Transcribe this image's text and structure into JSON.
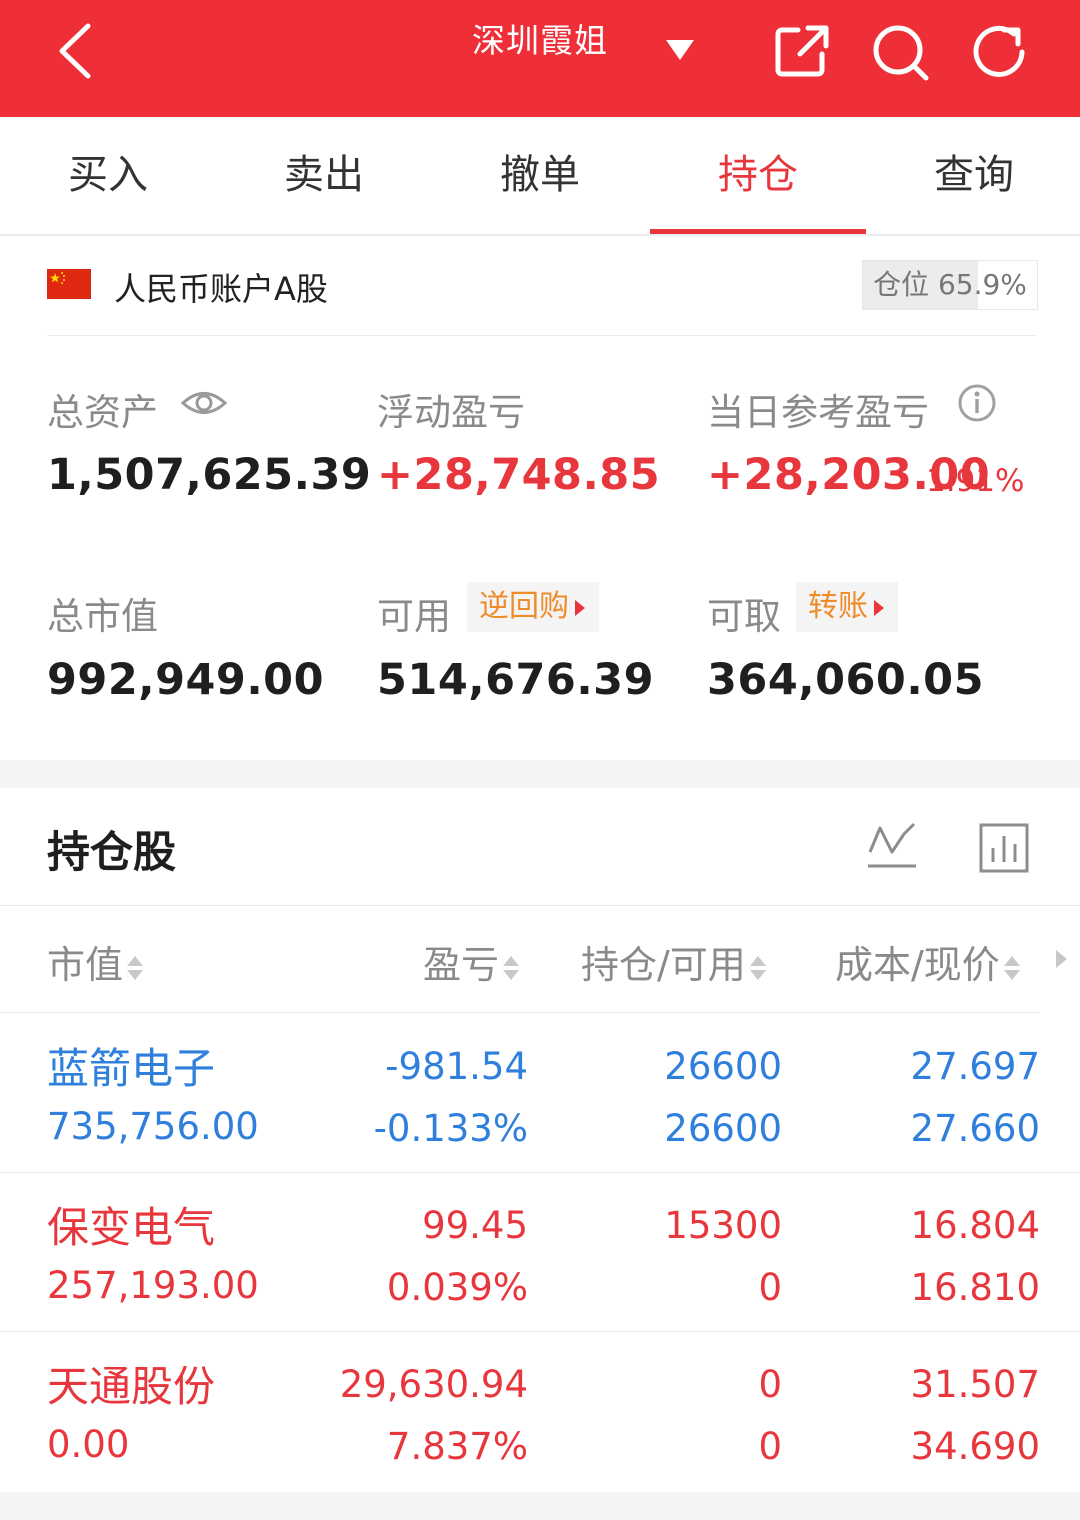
{
  "header": {
    "title": "深圳霞姐",
    "icons": [
      "back-icon",
      "dropdown-icon",
      "share-icon",
      "search-icon",
      "refresh-icon"
    ],
    "bg_color": "#ee2f37"
  },
  "tabs": [
    {
      "label": "买入",
      "active": false
    },
    {
      "label": "卖出",
      "active": false
    },
    {
      "label": "撤单",
      "active": false
    },
    {
      "label": "持仓",
      "active": true
    },
    {
      "label": "查询",
      "active": false
    }
  ],
  "account": {
    "name": "人民币账户A股",
    "position_label": "仓位 65.9%",
    "position_ratio": 0.659
  },
  "summary": {
    "total_assets_label": "总资产",
    "total_assets": "1,507,625.39",
    "floating_pl_label": "浮动盈亏",
    "floating_pl": "+28,748.85",
    "daily_pl_label": "当日参考盈亏",
    "daily_pl": "+28,203.00",
    "daily_pl_pct": "1.91%",
    "market_value_label": "总市值",
    "market_value": "992,949.00",
    "available_label": "可用",
    "available": "514,676.39",
    "reverse_repo_label": "逆回购",
    "withdrawable_label": "可取",
    "withdrawable": "364,060.05",
    "transfer_label": "转账"
  },
  "holdings": {
    "title": "持仓股",
    "columns": [
      "市值",
      "盈亏",
      "持仓/可用",
      "成本/现价"
    ],
    "rows": [
      {
        "name": "蓝箭电子",
        "market_value": "735,756.00",
        "pl": "-981.54",
        "pl_pct": "-0.133%",
        "hold": "26600",
        "avail": "26600",
        "cost": "27.697",
        "price": "27.660",
        "color": "blue"
      },
      {
        "name": "保变电气",
        "market_value": "257,193.00",
        "pl": "99.45",
        "pl_pct": "0.039%",
        "hold": "15300",
        "avail": "0",
        "cost": "16.804",
        "price": "16.810",
        "color": "red"
      },
      {
        "name": "天通股份",
        "market_value": "0.00",
        "pl": "29,630.94",
        "pl_pct": "7.837%",
        "hold": "0",
        "avail": "0",
        "cost": "31.507",
        "price": "34.690",
        "color": "red"
      }
    ]
  },
  "colors": {
    "up": "#e8363d",
    "down": "#2f7fdc",
    "accent": "#f08b2b"
  }
}
